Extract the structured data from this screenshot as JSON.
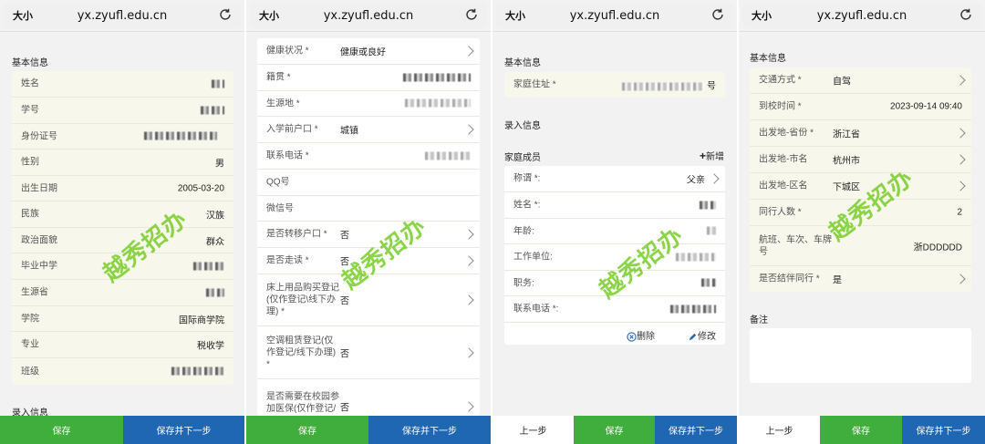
{
  "browser": {
    "size_label": "大小",
    "url": "yx.zyufl.edu.cn"
  },
  "panel1": {
    "section_title": "基本信息",
    "rows": [
      {
        "label": "姓名",
        "value": ""
      },
      {
        "label": "学号",
        "value": ""
      },
      {
        "label": "身份证号",
        "value": ""
      },
      {
        "label": "性别",
        "value": "男"
      },
      {
        "label": "出生日期",
        "value": "2005-03-20"
      },
      {
        "label": "民族",
        "value": "汉族"
      },
      {
        "label": "政治面貌",
        "value": "群众"
      },
      {
        "label": "毕业中学",
        "value": ""
      },
      {
        "label": "生源省",
        "value": ""
      },
      {
        "label": "学院",
        "value": "国际商学院"
      },
      {
        "label": "专业",
        "value": "税收学"
      },
      {
        "label": "班级",
        "value": ""
      }
    ],
    "next_section": "录入信息",
    "save": "保存",
    "save_next": "保存并下一步"
  },
  "panel2": {
    "rows": [
      {
        "label": "健康状况 *",
        "value": "健康或良好",
        "chevron": true
      },
      {
        "label": "籍贯 *",
        "value": "",
        "chevron": false
      },
      {
        "label": "生源地 *",
        "value": "",
        "chevron": false
      },
      {
        "label": "入学前户口 *",
        "value": "城镇",
        "chevron": true
      },
      {
        "label": "联系电话 *",
        "value": "",
        "chevron": false
      },
      {
        "label": "QQ号",
        "value": "",
        "chevron": false
      },
      {
        "label": "微信号",
        "value": "",
        "chevron": false
      },
      {
        "label": "是否转移户口 *",
        "value": "否",
        "chevron": true
      },
      {
        "label": "是否走读 *",
        "value": "否",
        "chevron": true
      },
      {
        "label": "床上用品购买登记\n(仅作登记\\线下办\n理) *",
        "value": "否",
        "chevron": true
      },
      {
        "label": "空调租赁登记(仅\n作登记/线下办理)\n*",
        "value": "否",
        "chevron": true
      },
      {
        "label": "是否需要在校园参\n加医保(仅作登记/",
        "value": "否",
        "chevron": true
      }
    ],
    "save": "保存",
    "save_next": "保存并下一步"
  },
  "panel3": {
    "section_title": "基本信息",
    "address_label": "家庭住址 *",
    "address_value": "号",
    "entry_section": "录入信息",
    "family_title": "家庭成员",
    "add_label": "新增",
    "rows": [
      {
        "label": "称谓 *:",
        "value": "父亲",
        "chevron": true
      },
      {
        "label": "姓名 *:",
        "value": ""
      },
      {
        "label": "年龄:",
        "value": ""
      },
      {
        "label": "工作单位:",
        "value": ""
      },
      {
        "label": "职务:",
        "value": ""
      },
      {
        "label": "联系电话 *:",
        "value": ""
      }
    ],
    "delete_label": "删除",
    "edit_label": "修改",
    "prev": "上一步",
    "save": "保存",
    "save_next": "保存并下一步"
  },
  "panel4": {
    "section_title": "基本信息",
    "rows": [
      {
        "label": "交通方式 *",
        "value": "自驾",
        "chevron": true
      },
      {
        "label": "到校时间 *",
        "value": "2023-09-14 09:40",
        "chevron": false
      },
      {
        "label": "出发地-省份 *",
        "value": "浙江省",
        "chevron": true
      },
      {
        "label": "出发地-市名",
        "value": "杭州市",
        "chevron": true
      },
      {
        "label": "出发地-区名",
        "value": "下城区",
        "chevron": true
      },
      {
        "label": "同行人数 *",
        "value": "2",
        "chevron": false
      },
      {
        "label": "航班、车次、车牌\n号",
        "value": "浙DDDDDD",
        "chevron": false
      },
      {
        "label": "是否结伴同行 *",
        "value": "是",
        "chevron": true
      }
    ],
    "notes_title": "备注",
    "prev": "上一步",
    "save": "保存",
    "save_next": "保存并下一步"
  },
  "watermark": "越秀招办"
}
